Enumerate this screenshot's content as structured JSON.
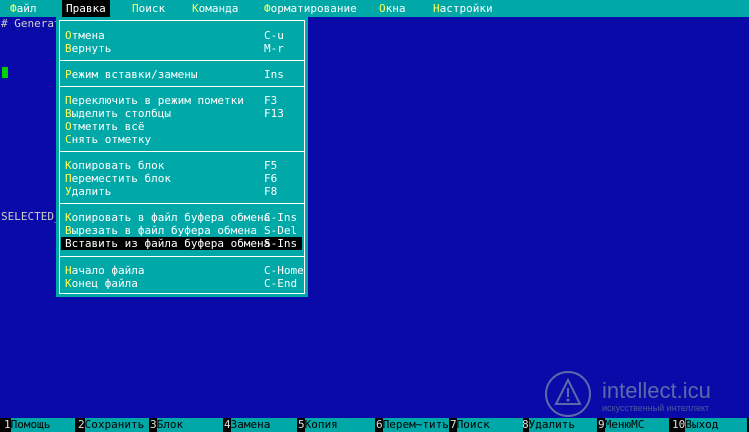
{
  "menubar": {
    "items": [
      {
        "hk": "Ф",
        "rest": "айл"
      },
      {
        "hk": "П",
        "rest": "равка"
      },
      {
        "hk": "П",
        "rest": "оиск"
      },
      {
        "hk": "К",
        "rest": "оманда"
      },
      {
        "hk": "Ф",
        "rest": "орматирование"
      },
      {
        "hk": "О",
        "rest": "кна"
      },
      {
        "hk": "Н",
        "rest": "астройки"
      }
    ]
  },
  "editor": {
    "line1": "# Generat",
    "line2": "SELECTED_"
  },
  "dropdown": {
    "items": [
      {
        "hk": "О",
        "rest": "тмена",
        "key": "C-u"
      },
      {
        "hk": "В",
        "rest": "ернуть",
        "key": "M-r"
      },
      {
        "hk": "Р",
        "rest": "ежим вставки/замены",
        "key": "Ins"
      },
      {
        "hk": "П",
        "rest": "ереключить в режим пометки",
        "key": "F3"
      },
      {
        "hk": "В",
        "rest": "ыделить столбцы",
        "key": "F13"
      },
      {
        "hk": "О",
        "rest": "тметить всё",
        "key": ""
      },
      {
        "hk": "С",
        "rest": "нять отметку",
        "key": ""
      },
      {
        "hk": "К",
        "rest": "опировать блок",
        "key": "F5"
      },
      {
        "hk": "П",
        "rest": "ереместить блок",
        "key": "F6"
      },
      {
        "hk": "У",
        "rest": "далить",
        "key": "F8"
      },
      {
        "hk": "К",
        "rest": "опировать в файл буфера обмена",
        "key": "C-Ins"
      },
      {
        "hk": "В",
        "rest": "ырезать в файл буфера обмена",
        "key": "S-Del"
      },
      {
        "hk": "В",
        "rest": "ставить из файла буфера обмена",
        "key": "S-Ins"
      },
      {
        "hk": "Н",
        "rest": "ачало файла",
        "key": "C-Home"
      },
      {
        "hk": "К",
        "rest": "онец файла",
        "key": "C-End"
      }
    ]
  },
  "fnbar": {
    "keys": [
      {
        "num": "1",
        "label": "Помощь"
      },
      {
        "num": "2",
        "label": "Сохранить"
      },
      {
        "num": "3",
        "label": "Блок"
      },
      {
        "num": "4",
        "label": "Замена"
      },
      {
        "num": "5",
        "label": "Копия"
      },
      {
        "num": "6",
        "label": "Перем~тить"
      },
      {
        "num": "7",
        "label": "Поиск"
      },
      {
        "num": "8",
        "label": "Удалить"
      },
      {
        "num": "9",
        "label": "МенюMC"
      },
      {
        "num": "10",
        "label": "Выход"
      }
    ]
  },
  "watermark": {
    "text": "intellect.icu",
    "sub": "искусственный интеллект"
  }
}
